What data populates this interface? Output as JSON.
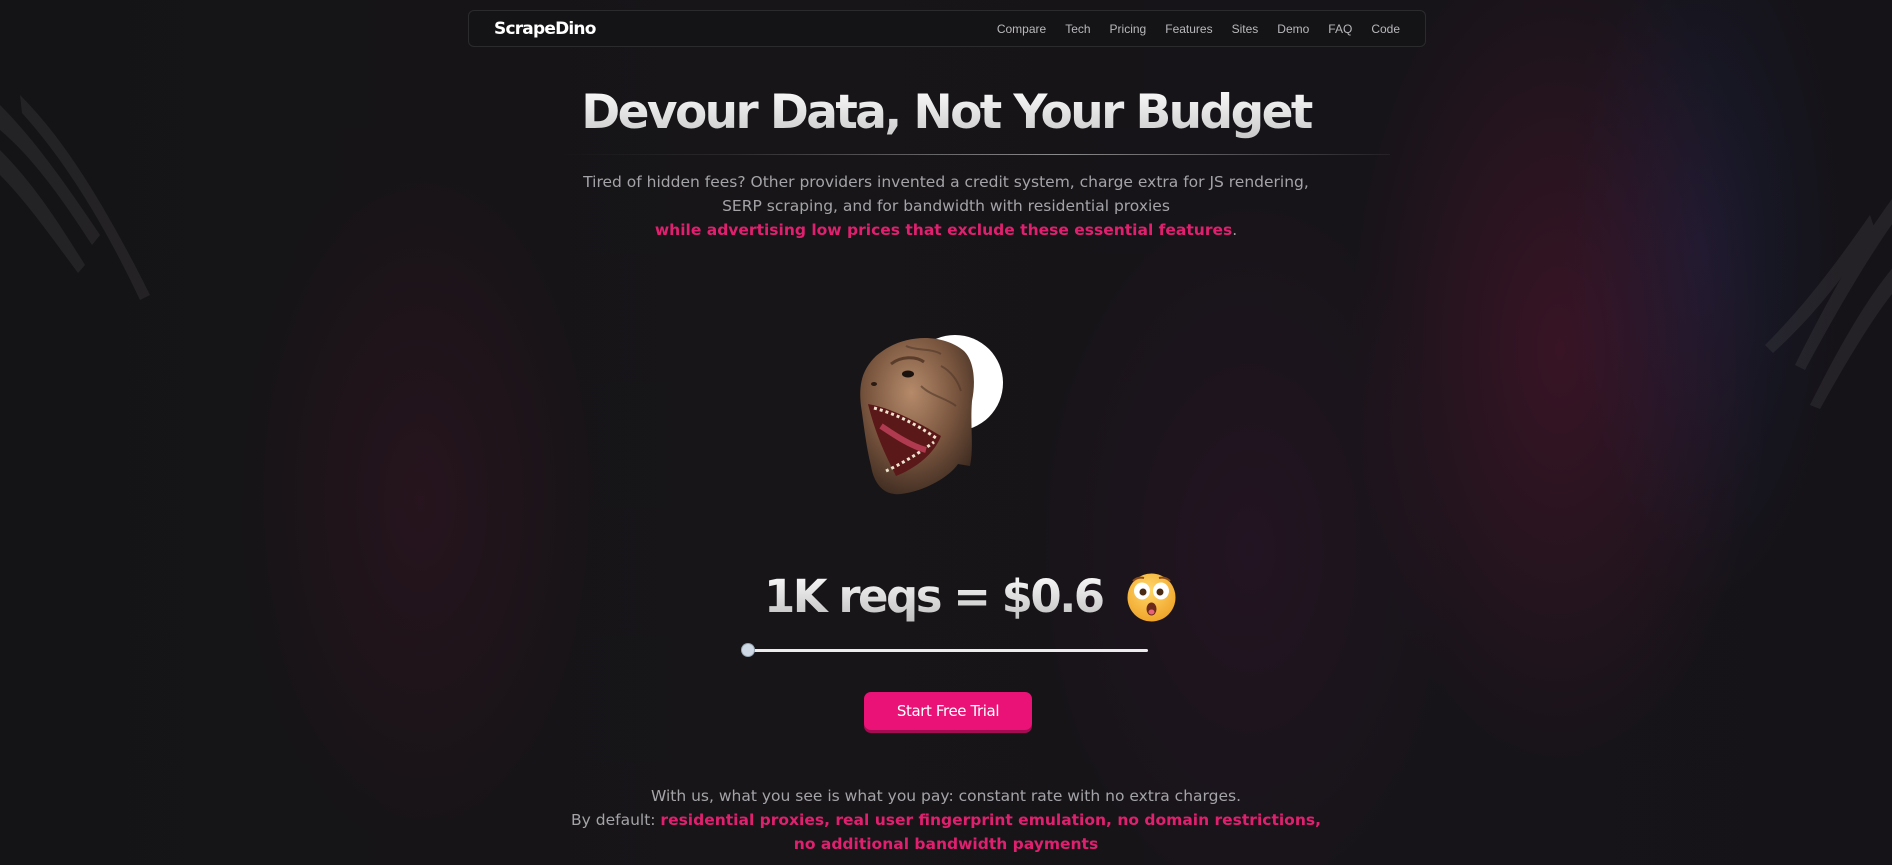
{
  "navbar": {
    "brand": "ScrapeDino",
    "links": [
      "Compare",
      "Tech",
      "Pricing",
      "Features",
      "Sites",
      "Demo",
      "FAQ",
      "Code"
    ]
  },
  "hero": {
    "title": "Devour Data, Not Your Budget",
    "subtitle_line1": "Tired of hidden fees? Other providers invented a credit system, charge extra for JS rendering,",
    "subtitle_line2": "SERP scraping, and for bandwidth with residential proxies",
    "subtitle_accent": "while advertising low prices that exclude these essential features",
    "subtitle_end": "."
  },
  "pricing": {
    "price_text": "1K reqs = $0.6",
    "slider_value": 0,
    "emoji": "astonished-face-icon"
  },
  "cta": {
    "label": "Start Free Trial"
  },
  "bottom": {
    "line1": "With us, what you see is what you pay: constant rate with no extra charges.",
    "prefix": "By default: ",
    "accent": "residential proxies, real user fingerprint emulation, no domain restrictions, no additional bandwidth payments"
  },
  "colors": {
    "accent": "#e0206f",
    "cta": "#ea1276",
    "background": "#121113"
  }
}
